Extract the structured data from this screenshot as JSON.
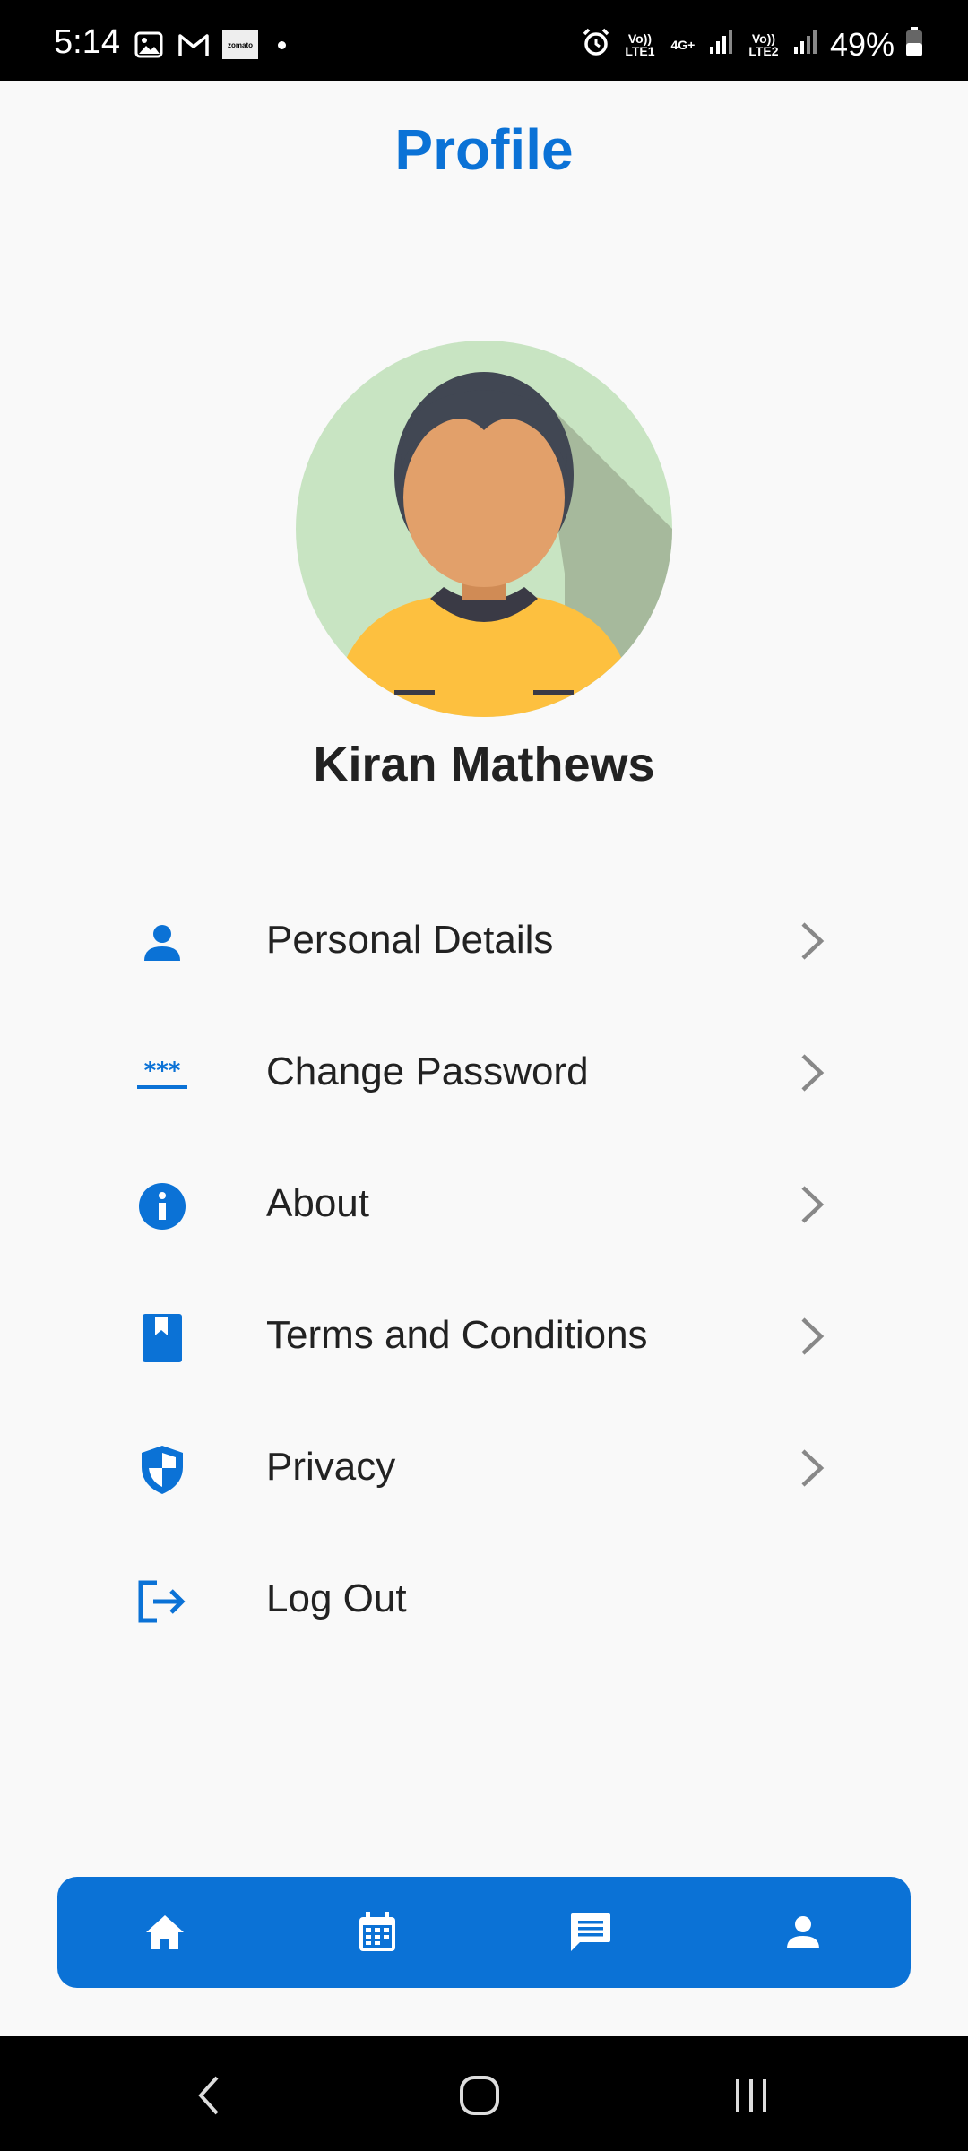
{
  "status_bar": {
    "time": "5:14",
    "network_1": "Vo)) LTE1",
    "network_4g": "4G+",
    "network_2": "Vo)) LTE2",
    "battery": "49%",
    "app_badge": "zomato"
  },
  "header": {
    "title": "Profile"
  },
  "profile": {
    "name": "Kiran Mathews"
  },
  "menu": {
    "items": [
      {
        "label": "Personal Details",
        "icon": "person-icon"
      },
      {
        "label": "Change Password",
        "icon": "password-icon"
      },
      {
        "label": "About",
        "icon": "info-icon"
      },
      {
        "label": "Terms and Conditions",
        "icon": "book-icon"
      },
      {
        "label": "Privacy",
        "icon": "shield-icon"
      },
      {
        "label": "Log Out",
        "icon": "logout-icon"
      }
    ]
  },
  "bottom_nav": {
    "items": [
      {
        "icon": "home-icon"
      },
      {
        "icon": "calendar-icon"
      },
      {
        "icon": "chat-icon"
      },
      {
        "icon": "profile-icon"
      }
    ]
  },
  "colors": {
    "accent": "#0b72d6",
    "background": "#f9f9f9",
    "text": "#222222"
  }
}
